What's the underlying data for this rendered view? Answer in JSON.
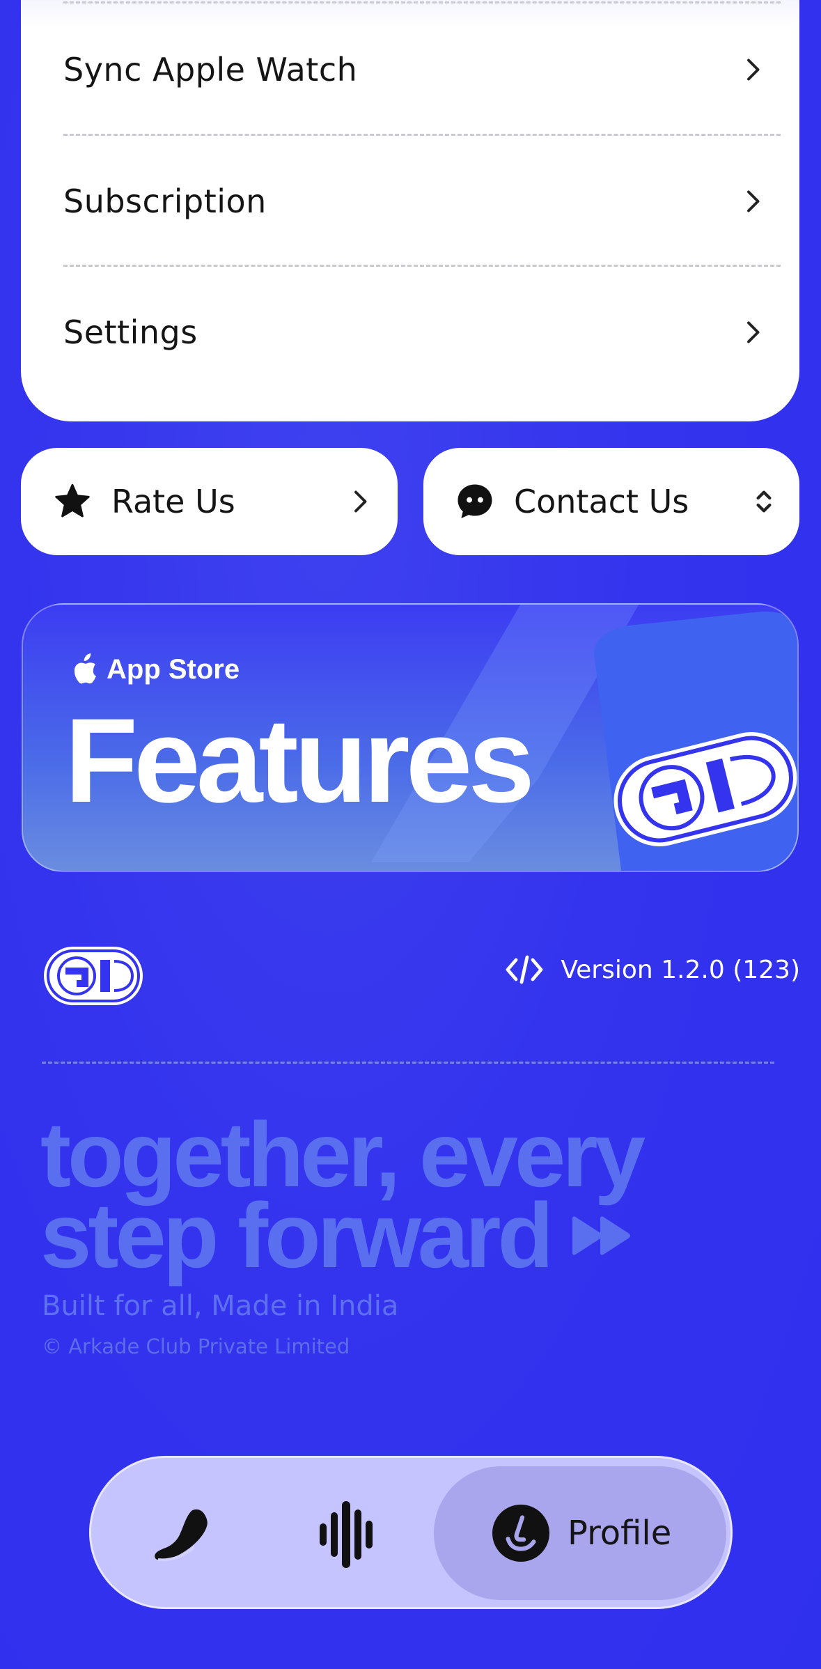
{
  "menu": {
    "items": [
      {
        "label": "Sync Apple Watch"
      },
      {
        "label": "Subscription"
      },
      {
        "label": "Settings"
      }
    ]
  },
  "actions": {
    "rate_label": "Rate Us",
    "contact_label": "Contact Us"
  },
  "banner": {
    "store_label": "App Store",
    "title": "Features"
  },
  "footer": {
    "version": "Version 1.2.0 (123)",
    "tagline_line1": "together, every",
    "tagline_line2": "step forward",
    "built": "Built for all, Made in India",
    "copyright": "© Arkade Club Private Limited"
  },
  "tabbar": {
    "tabs": [
      {
        "icon": "shoe-icon"
      },
      {
        "icon": "soundwave-icon"
      },
      {
        "icon": "profile-icon",
        "label": "Profile",
        "active": true
      }
    ]
  },
  "colors": {
    "background": "#3434ee",
    "card": "#ffffff",
    "tagline": "#5a6ff0",
    "tabbar": "#d2d0ff",
    "tab_active": "#aaa6ee"
  }
}
